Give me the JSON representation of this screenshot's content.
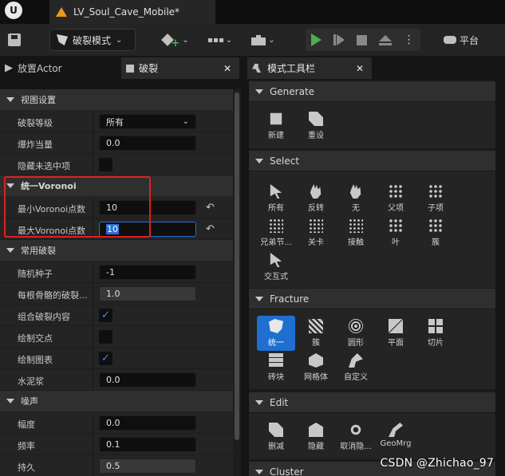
{
  "app": {
    "logo_letter": "U",
    "document_tab": "LV_Soul_Cave_Mobile*"
  },
  "toolbar": {
    "mode_label": "破裂模式",
    "platform_label": "平台"
  },
  "left_panel": {
    "tabs": [
      {
        "label": "放置Actor"
      },
      {
        "label": "破裂"
      }
    ],
    "categories": {
      "view": "视图设置",
      "voronoi": "统一Voronoi",
      "common": "常用破裂",
      "noise": "噪声"
    },
    "rows": {
      "fracture_level": {
        "label": "破裂等级",
        "value": "所有"
      },
      "explode_amount": {
        "label": "爆炸当量",
        "value": "0.0"
      },
      "hide_unselected": {
        "label": "隐藏未选中项",
        "checked": false
      },
      "min_voronoi": {
        "label": "最小Voronoi点数",
        "value": "10"
      },
      "max_voronoi": {
        "label": "最大Voronoi点数",
        "value": "10"
      },
      "random_seed": {
        "label": "随机种子",
        "value": "-1"
      },
      "fracture_per_bone": {
        "label": "每根骨骼的破裂...",
        "value": "1.0"
      },
      "combine_content": {
        "label": "组合破裂内容",
        "checked": true
      },
      "draw_sites": {
        "label": "绘制交点",
        "checked": false
      },
      "draw_diagram": {
        "label": "绘制图表",
        "checked": true
      },
      "grout": {
        "label": "水泥浆",
        "value": "0.0"
      },
      "amplitude": {
        "label": "幅度",
        "value": "0.0"
      },
      "frequency": {
        "label": "频率",
        "value": "0.1"
      },
      "persistence": {
        "label": "持久",
        "value": "0.5"
      }
    }
  },
  "right_panel": {
    "tab_label": "模式工具栏",
    "sections": {
      "generate": {
        "title": "Generate",
        "tools": [
          "新建",
          "重设"
        ]
      },
      "select": {
        "title": "Select",
        "tools": [
          "所有",
          "反转",
          "无",
          "父项",
          "子项",
          "兄弟节...",
          "关卡",
          "接触",
          "叶",
          "簇",
          "交互式"
        ]
      },
      "fracture": {
        "title": "Fracture",
        "tools": [
          "统一",
          "簇",
          "圆形",
          "平面",
          "切片",
          "砖块",
          "网格体",
          "自定义"
        ]
      },
      "edit": {
        "title": "Edit",
        "tools": [
          "删减",
          "隐藏",
          "取消隐...",
          "GeoMrg"
        ]
      },
      "cluster": {
        "title": "Cluster"
      }
    }
  },
  "watermark": "CSDN @Zhichao_97",
  "colors": {
    "accent_blue": "#1e6fd0",
    "highlight_red": "#e02020",
    "play_green": "#4caf50",
    "tab_icon_orange": "#e89a1a"
  }
}
